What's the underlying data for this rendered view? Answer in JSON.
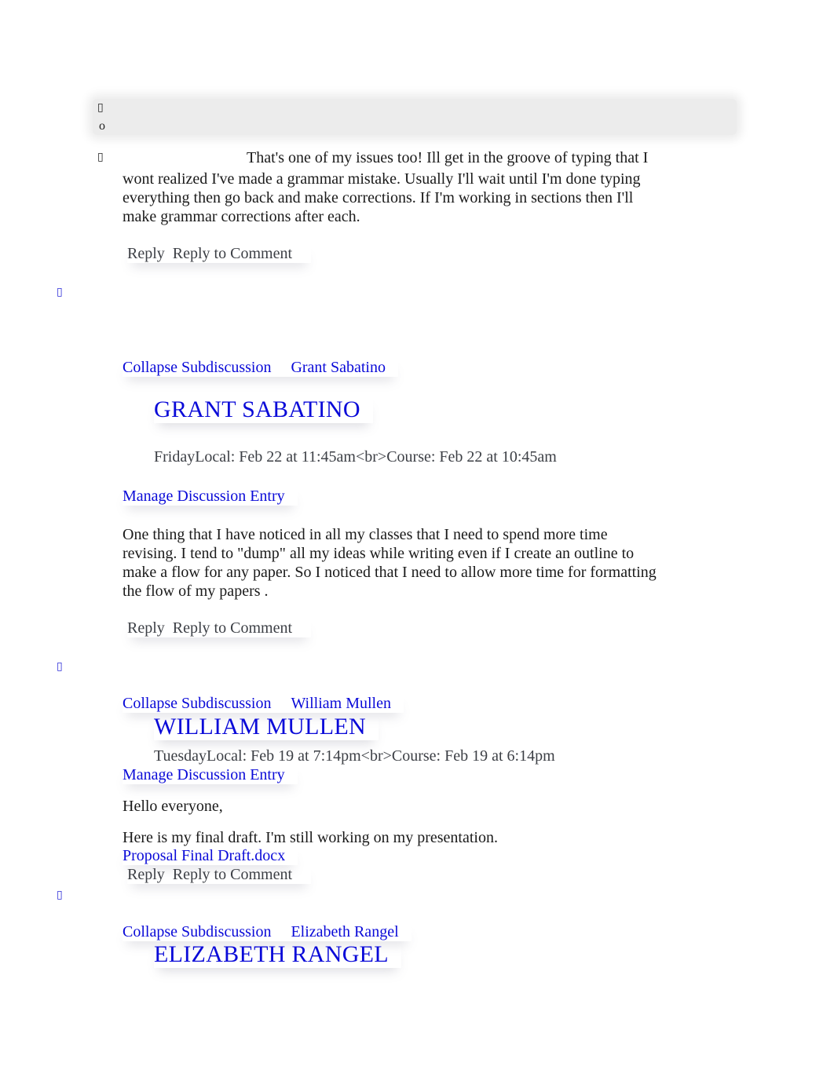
{
  "bullets": {
    "square": "▯",
    "circle": "o"
  },
  "first_comment": {
    "text": "That's one of my issues too! Ill get in the groove of typing that I wont realized I've made a grammar mistake. Usually I'll wait until I'm done typing everything then go back and make corrections. If I'm working in sections then I'll make grammar corrections after each.",
    "line1": "That's one of my issues too! Ill get in the groove of typing that I",
    "line2": "wont realized I've made a grammar mistake. Usually I'll wait until I'm done typing",
    "line3": "everything then go back and make corrections. If I'm working in sections then I'll",
    "line4": "make grammar corrections after each.",
    "reply_label": "Reply",
    "reply_to_comment_label": "Reply to Comment"
  },
  "entries": [
    {
      "collapse_label": "Collapse Subdiscussion",
      "author_link": "Grant Sabatino",
      "author_heading": "GRANT SABATINO",
      "timestamp": "FridayLocal: Feb 22 at 11:45am<br>Course: Feb 22 at 10:45am",
      "manage_label": "Manage Discussion Entry",
      "body": [
        "One thing that I have noticed in all my classes that I need to spend more time",
        "revising. I tend to \"dump\" all my ideas while writing even if I create an outline to",
        "make a flow for any paper. So I noticed that I need to allow more time for formatting",
        "the flow of my papers ."
      ],
      "reply_label": "Reply",
      "reply_to_comment_label": "Reply to Comment"
    },
    {
      "collapse_label": "Collapse Subdiscussion",
      "author_link": "William Mullen",
      "author_heading": "WILLIAM MULLEN",
      "timestamp": "TuesdayLocal: Feb 19 at 7:14pm<br>Course: Feb 19 at 6:14pm",
      "manage_label": "Manage Discussion Entry",
      "greeting": "Hello everyone,",
      "body": "Here is my final draft. I'm still working on my presentation.",
      "attachment": "Proposal Final Draft.docx",
      "reply_label": "Reply",
      "reply_to_comment_label": "Reply to Comment"
    },
    {
      "collapse_label": "Collapse Subdiscussion",
      "author_link": "Elizabeth Rangel",
      "author_heading": "ELIZABETH RANGEL"
    }
  ]
}
